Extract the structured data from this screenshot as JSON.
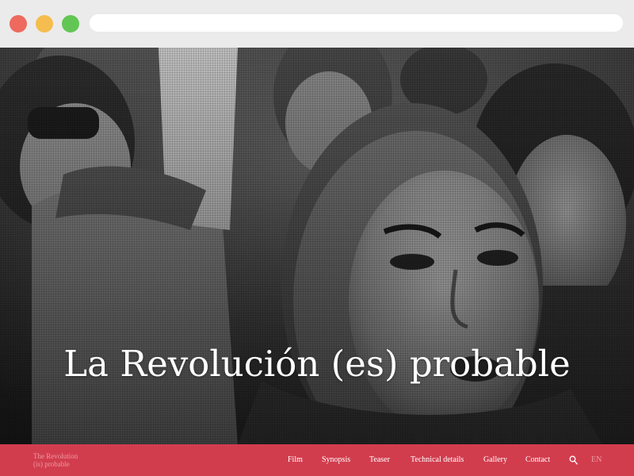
{
  "browser": {
    "address": ""
  },
  "hero": {
    "title": "La Revolución (es) probable"
  },
  "nav": {
    "brand_line1": "The Revolution",
    "brand_line2": "(is) probable",
    "links": [
      "Film",
      "Synopsis",
      "Teaser",
      "Technical details",
      "Gallery",
      "Contact"
    ],
    "search_icon": "search-icon",
    "language": "EN"
  },
  "colors": {
    "nav_background": "#d23d4e",
    "nav_muted_text": "#ec9aa3",
    "nav_text": "#ffffff",
    "chrome_background": "#ebebeb",
    "traffic_red": "#ee6a5e",
    "traffic_yellow": "#f5bd4f",
    "traffic_green": "#62c654"
  }
}
